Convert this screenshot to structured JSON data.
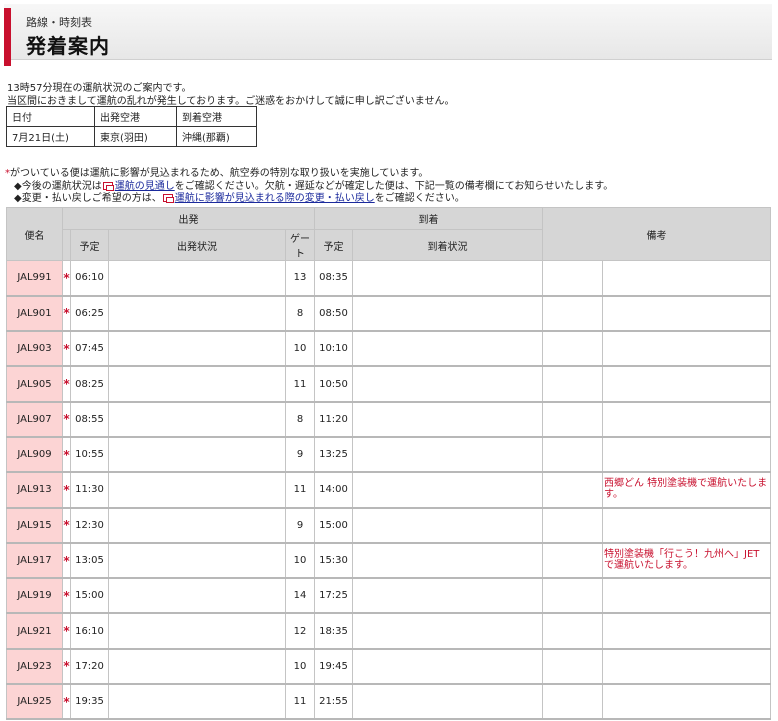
{
  "header": {
    "sub": "路線・時刻表",
    "title": "発着案内"
  },
  "status": {
    "line1": "13時57分現在の運航状況のご案内です。",
    "line2": "当区間におきまして運航の乱れが発生しております。ご迷惑をおかけして誠に申し訳ございません。"
  },
  "route": {
    "headers": [
      "日付",
      "出発空港",
      "到着空港"
    ],
    "values": [
      "7月21日(土)",
      "東京(羽田)",
      "沖縄(那覇)"
    ]
  },
  "notes": {
    "asterisk": "*",
    "line1": "がついている便は運航に影響が見込まれるため、航空券の特別な取り扱いを実施しています。",
    "line2_pre": "◆今後の運航状況は",
    "line2_link": "運航の見通し",
    "line2_post": "をご確認ください。欠航・遅延などが確定した便は、下記一覧の備考欄にてお知らせいたします。",
    "line3_pre": "◆変更・払い戻しご希望の方は、",
    "line3_link": "運航に影響が見込まれる際の変更・払い戻し",
    "line3_post": "をご確認ください。"
  },
  "table": {
    "headers": {
      "flight": "便名",
      "departure": "出発",
      "arrival": "到着",
      "remarks": "備考",
      "scheduled": "予定",
      "dep_status": "出発状況",
      "gate": "ゲート",
      "arr_status": "到着状況"
    },
    "rows": [
      {
        "flight": "JAL991",
        "mark": "*",
        "dep": "06:10",
        "gate": "13",
        "arr": "08:35",
        "remark": ""
      },
      {
        "flight": "JAL901",
        "mark": "*",
        "dep": "06:25",
        "gate": "8",
        "arr": "08:50",
        "remark": ""
      },
      {
        "flight": "JAL903",
        "mark": "*",
        "dep": "07:45",
        "gate": "10",
        "arr": "10:10",
        "remark": ""
      },
      {
        "flight": "JAL905",
        "mark": "*",
        "dep": "08:25",
        "gate": "11",
        "arr": "10:50",
        "remark": ""
      },
      {
        "flight": "JAL907",
        "mark": "*",
        "dep": "08:55",
        "gate": "8",
        "arr": "11:20",
        "remark": ""
      },
      {
        "flight": "JAL909",
        "mark": "*",
        "dep": "10:55",
        "gate": "9",
        "arr": "13:25",
        "remark": ""
      },
      {
        "flight": "JAL913",
        "mark": "*",
        "dep": "11:30",
        "gate": "11",
        "arr": "14:00",
        "remark": "西郷どん 特別塗装機で運航いたします。"
      },
      {
        "flight": "JAL915",
        "mark": "*",
        "dep": "12:30",
        "gate": "9",
        "arr": "15:00",
        "remark": ""
      },
      {
        "flight": "JAL917",
        "mark": "*",
        "dep": "13:05",
        "gate": "10",
        "arr": "15:30",
        "remark": "特別塗装機「行こう！九州へ」JETで運航いたします。"
      },
      {
        "flight": "JAL919",
        "mark": "*",
        "dep": "15:00",
        "gate": "14",
        "arr": "17:25",
        "remark": ""
      },
      {
        "flight": "JAL921",
        "mark": "*",
        "dep": "16:10",
        "gate": "12",
        "arr": "18:35",
        "remark": ""
      },
      {
        "flight": "JAL923",
        "mark": "*",
        "dep": "17:20",
        "gate": "10",
        "arr": "19:45",
        "remark": ""
      },
      {
        "flight": "JAL925",
        "mark": "*",
        "dep": "19:35",
        "gate": "11",
        "arr": "21:55",
        "remark": ""
      }
    ]
  },
  "colors": {
    "accent": "#c8102e",
    "flight_cell": "#fcd4d4",
    "header_bg": "#d6d6d6",
    "link": "#1b2a9c"
  }
}
